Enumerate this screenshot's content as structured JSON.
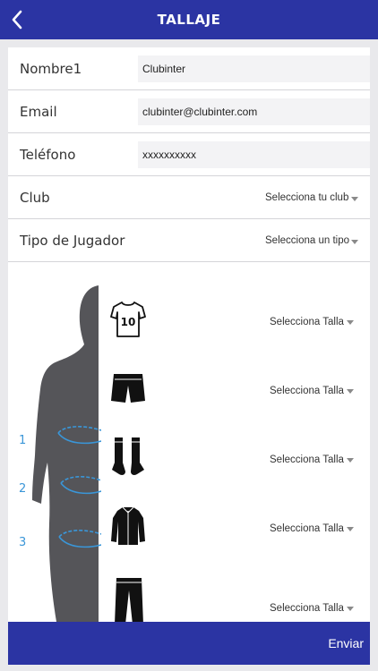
{
  "header": {
    "title": "TALLAJE",
    "back_icon": "chevron-left-icon"
  },
  "form": {
    "name": {
      "label": "Nombre1",
      "value": "Clubinter"
    },
    "email": {
      "label": "Email",
      "value": "clubinter@clubinter.com"
    },
    "phone": {
      "label": "Teléfono",
      "value": "xxxxxxxxxx"
    },
    "club": {
      "label": "Club",
      "selected": "Selecciona tu club"
    },
    "player_type": {
      "label": "Tipo de Jugador",
      "selected": "Selecciona un tipo"
    }
  },
  "sizes": {
    "measure_numbers": [
      "1",
      "2",
      "3"
    ],
    "items": [
      {
        "icon": "jersey-icon",
        "number": "10",
        "selected": "Selecciona Talla"
      },
      {
        "icon": "shorts-icon",
        "selected": "Selecciona Talla"
      },
      {
        "icon": "socks-icon",
        "selected": "Selecciona Talla"
      },
      {
        "icon": "jacket-icon",
        "selected": "Selecciona Talla"
      },
      {
        "icon": "pants-icon",
        "selected": "Selecciona Talla"
      }
    ]
  },
  "footer": {
    "submit_label": "Enviar"
  },
  "colors": {
    "primary": "#2b34a3",
    "accent": "#3a96d8",
    "silhouette": "#555559"
  }
}
